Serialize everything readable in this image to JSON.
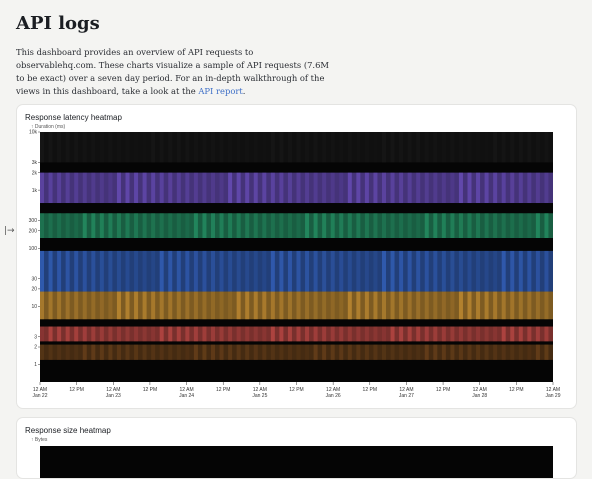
{
  "page": {
    "title": "API logs",
    "intro_text": "This dashboard provides an overview of API requests to observablehq.com. These charts visualize a sample of API requests (7.6M to be exact) over a seven day period. For an in-depth walkthrough of the views in this dashboard, take a look at the ",
    "intro_link": "API report",
    "intro_end": ".",
    "toggle_glyph": "|→"
  },
  "cards": [
    {
      "title": "Response latency heatmap",
      "axis_caption": "↑ Duration (ms)"
    },
    {
      "title": "Response size heatmap",
      "axis_caption": "↑ Bytes"
    }
  ],
  "chart_data": [
    {
      "type": "heatmap",
      "title": "Response latency heatmap",
      "ylabel": "↑ Duration (ms)",
      "yscale": "log",
      "ylim": [
        0.5,
        10000
      ],
      "y_ticks": [
        "1",
        "2",
        "3",
        "10",
        "20",
        "30",
        "100",
        "200",
        "300",
        "1k",
        "2k",
        "3k",
        "10k"
      ],
      "y_tick_values": [
        1,
        2,
        3,
        10,
        20,
        30,
        100,
        200,
        300,
        1000,
        2000,
        3000,
        10000
      ],
      "x_ticks": [
        {
          "time": "12 AM",
          "day": "Jan 22"
        },
        {
          "time": "12 PM",
          "day": ""
        },
        {
          "time": "12 AM",
          "day": "Jan 23"
        },
        {
          "time": "12 PM",
          "day": ""
        },
        {
          "time": "12 AM",
          "day": "Jan 24"
        },
        {
          "time": "12 PM",
          "day": ""
        },
        {
          "time": "12 AM",
          "day": "Jan 25"
        },
        {
          "time": "12 PM",
          "day": ""
        },
        {
          "time": "12 AM",
          "day": "Jan 26"
        },
        {
          "time": "12 PM",
          "day": ""
        },
        {
          "time": "12 AM",
          "day": "Jan 27"
        },
        {
          "time": "12 PM",
          "day": ""
        },
        {
          "time": "12 AM",
          "day": "Jan 28"
        },
        {
          "time": "12 PM",
          "day": ""
        },
        {
          "time": "12 AM",
          "day": "Jan 29"
        }
      ],
      "bands": [
        {
          "y_from": 2.5,
          "y_to": 4.5,
          "color": "#d9534f"
        },
        {
          "y_from": 1.2,
          "y_to": 2.2,
          "color": "#7a4a1e"
        },
        {
          "y_from": 6,
          "y_to": 18,
          "color": "#e0a23a"
        },
        {
          "y_from": 18,
          "y_to": 90,
          "color": "#3b6fd8"
        },
        {
          "y_from": 150,
          "y_to": 400,
          "color": "#2aa874"
        },
        {
          "y_from": 600,
          "y_to": 2000,
          "color": "#7a5ad8"
        },
        {
          "y_from": 3000,
          "y_to": 10000,
          "color": "#1a1a1a"
        }
      ]
    },
    {
      "type": "heatmap",
      "title": "Response size heatmap",
      "ylabel": "↑ Bytes"
    }
  ]
}
